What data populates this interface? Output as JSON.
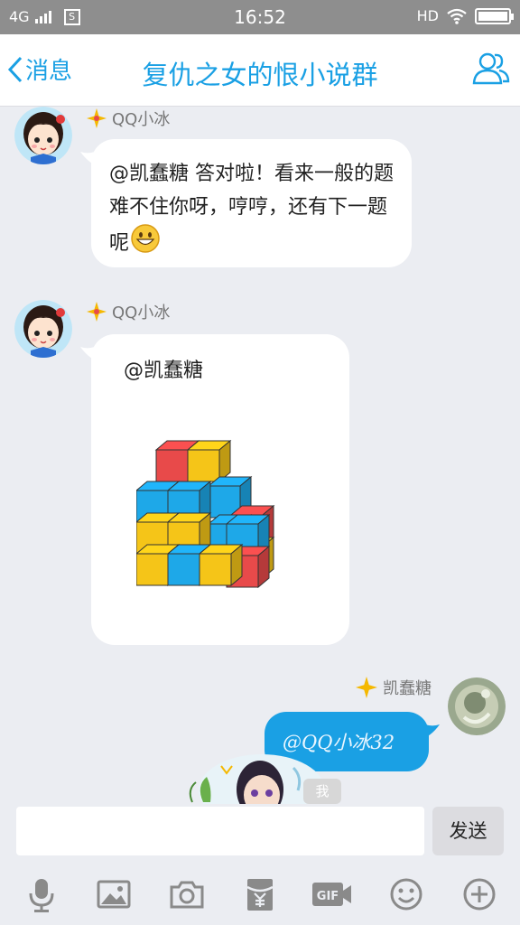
{
  "status_bar": {
    "network": "4G",
    "time": "16:52",
    "hd": "HD",
    "sim_label": "S",
    "battery_level": 1.0
  },
  "header": {
    "back_label": "消息",
    "title": "复仇之女的恨小说群"
  },
  "messages": [
    {
      "sender": "QQ小冰",
      "text": "@凯蠢糖 答对啦！看来一般的题难不住你呀，哼哼，还有下一题呢"
    },
    {
      "sender": "QQ小冰",
      "mention": "@凯蠢糖",
      "image": "cube-stack-puzzle"
    },
    {
      "sender": "凯蠢糖",
      "text": "@QQ小冰32"
    }
  ],
  "sticker_tag": "我",
  "input": {
    "value": "",
    "send_label": "发送"
  },
  "toolbar": [
    "microphone-icon",
    "image-icon",
    "camera-icon",
    "red-packet-icon",
    "gif-icon",
    "emoji-icon",
    "plus-icon"
  ],
  "colors": {
    "accent": "#1aa0e4",
    "background": "#ebedf2",
    "cube_red": "#e84a4a",
    "cube_yellow": "#f5c518",
    "cube_blue": "#1ea8e8"
  }
}
